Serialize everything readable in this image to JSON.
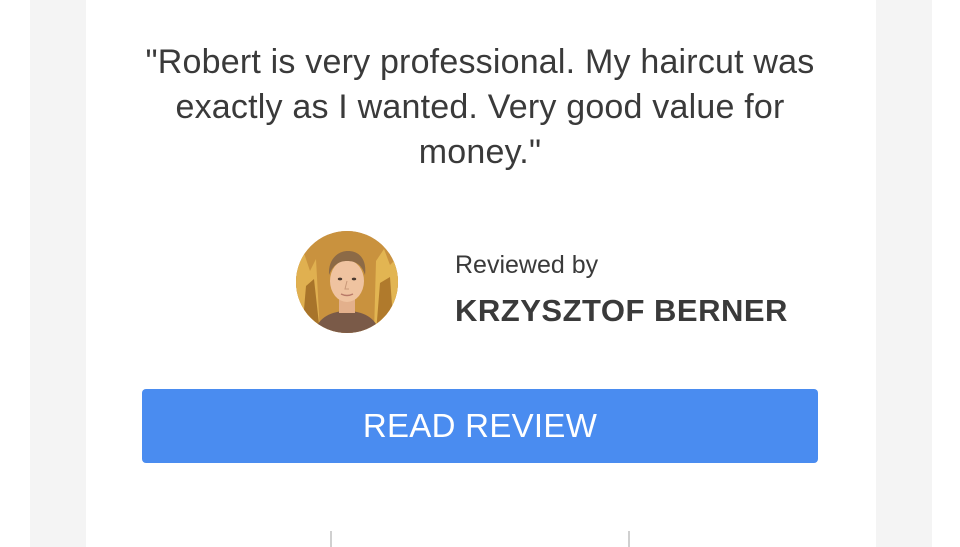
{
  "review": {
    "quote": "\"Robert is very professional. My haircut was exactly as I wanted. Very good value for money.\"",
    "reviewed_by_label": "Reviewed by",
    "reviewer_name": "KRZYSZTOF BERNER",
    "avatar_icon": "reviewer-avatar-photo"
  },
  "actions": {
    "read_review_label": "READ REVIEW"
  },
  "colors": {
    "button_blue": "#4a8cf0",
    "text": "#3a3a3a",
    "gutter": "#f4f4f4"
  }
}
